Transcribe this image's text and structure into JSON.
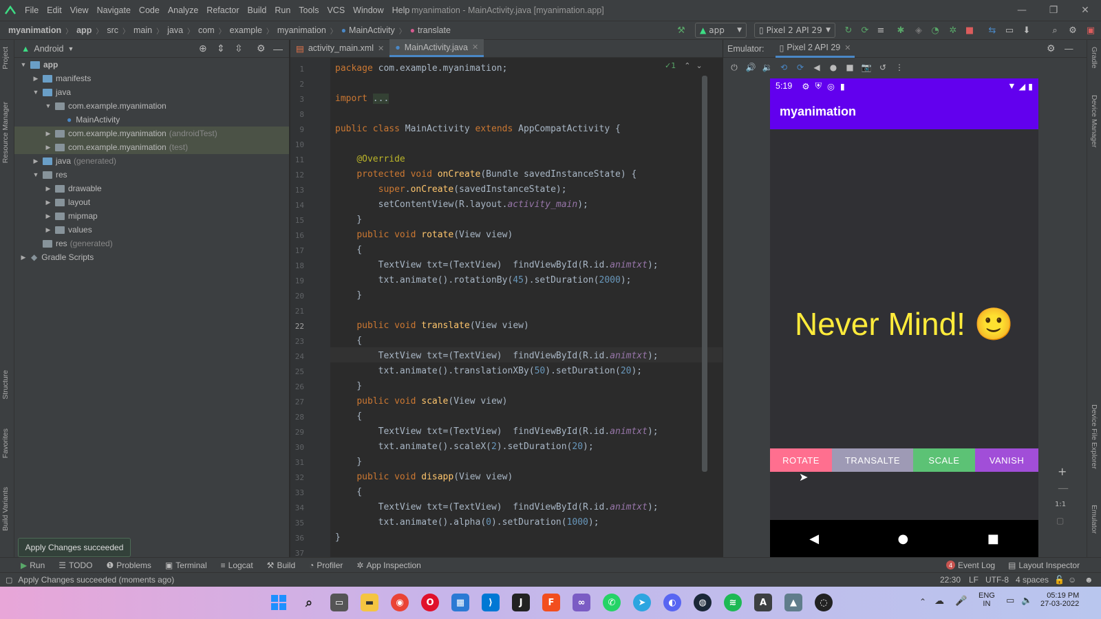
{
  "menu": {
    "items": [
      "File",
      "Edit",
      "View",
      "Navigate",
      "Code",
      "Analyze",
      "Refactor",
      "Build",
      "Run",
      "Tools",
      "VCS",
      "Window",
      "Help"
    ],
    "window_title": "myanimation - MainActivity.java [myanimation.app]"
  },
  "breadcrumb": [
    "myanimation",
    "app",
    "src",
    "main",
    "java",
    "com",
    "example",
    "myanimation",
    "MainActivity",
    "translate"
  ],
  "toolbar": {
    "run_config": "app",
    "device": "Pixel 2 API 29"
  },
  "left_strip": {
    "project": "Project",
    "resource_manager": "Resource Manager",
    "structure": "Structure",
    "favorites": "Favorites",
    "build_variants": "Build Variants"
  },
  "right_strip": {
    "gradle": "Gradle",
    "device_manager": "Device Manager",
    "device_file_explorer": "Device File Explorer",
    "emulator": "Emulator"
  },
  "project": {
    "view_mode": "Android",
    "tree": [
      {
        "label": "app",
        "hint": "",
        "bold": true
      },
      {
        "label": "manifests",
        "hint": ""
      },
      {
        "label": "java",
        "hint": ""
      },
      {
        "label": "com.example.myanimation",
        "hint": ""
      },
      {
        "label": "MainActivity",
        "hint": ""
      },
      {
        "label": "com.example.myanimation",
        "hint": "(androidTest)"
      },
      {
        "label": "com.example.myanimation",
        "hint": "(test)"
      },
      {
        "label": "java",
        "hint": "(generated)"
      },
      {
        "label": "res",
        "hint": ""
      },
      {
        "label": "drawable",
        "hint": ""
      },
      {
        "label": "layout",
        "hint": ""
      },
      {
        "label": "mipmap",
        "hint": ""
      },
      {
        "label": "values",
        "hint": ""
      },
      {
        "label": "res",
        "hint": "(generated)"
      },
      {
        "label": "Gradle Scripts",
        "hint": ""
      }
    ]
  },
  "editor": {
    "tabs": [
      "activity_main.xml",
      "MainActivity.java"
    ],
    "inspection_count": "1",
    "line_numbers": [
      "1",
      "2",
      "3",
      "8",
      "9",
      "10",
      "11",
      "12",
      "13",
      "14",
      "15",
      "16",
      "17",
      "18",
      "19",
      "20",
      "21",
      "22",
      "23",
      "24",
      "25",
      "26",
      "27",
      "28",
      "29",
      "30",
      "31",
      "32",
      "33",
      "34",
      "35",
      "36",
      "37"
    ],
    "code": [
      "package com.example.myanimation;",
      "",
      "import ...",
      "",
      "public class MainActivity extends AppCompatActivity {",
      "",
      "    @Override",
      "    protected void onCreate(Bundle savedInstanceState) {",
      "        super.onCreate(savedInstanceState);",
      "        setContentView(R.layout.activity_main);",
      "    }",
      "    public void rotate(View view)",
      "    {",
      "        TextView txt=(TextView)  findViewById(R.id.animtxt);",
      "        txt.animate().rotationBy(45).setDuration(2000);",
      "    }",
      "",
      "    public void translate(View view)",
      "    {",
      "        TextView txt=(TextView)  findViewById(R.id.animtxt);",
      "        txt.animate().translationXBy(50).setDuration(20);",
      "    }",
      "    public void scale(View view)",
      "    {",
      "        TextView txt=(TextView)  findViewById(R.id.animtxt);",
      "        txt.animate().scaleX(2).setDuration(20);",
      "    }",
      "    public void disapp(View view)",
      "    {",
      "        TextView txt=(TextView)  findViewById(R.id.animtxt);",
      "        txt.animate().alpha(0).setDuration(1000);",
      "}",
      ""
    ]
  },
  "emulator": {
    "label": "Emulator:",
    "device_tab": "Pixel 2 API 29",
    "phone": {
      "time": "5:19",
      "app_title": "myanimation",
      "big_text": "Never Mind! 🙂",
      "buttons": [
        {
          "label": "ROTATE",
          "color": "#ff6f8f"
        },
        {
          "label": "TRANSALTE",
          "color": "#9e9ab5"
        },
        {
          "label": "SCALE",
          "color": "#5cc275"
        },
        {
          "label": "VANISH",
          "color": "#a14ed8"
        }
      ]
    },
    "zoom_reset": "1:1"
  },
  "toast": "Apply Changes succeeded",
  "tool_windows": {
    "left": [
      "Run",
      "TODO",
      "Problems",
      "Terminal",
      "Logcat",
      "Build",
      "Profiler",
      "App Inspection"
    ],
    "event_log": "Event Log",
    "event_count": "4",
    "layout_inspector": "Layout Inspector"
  },
  "status": {
    "message": "Apply Changes succeeded (moments ago)",
    "position": "22:30",
    "line_sep": "LF",
    "encoding": "UTF-8",
    "indent": "4 spaces"
  },
  "taskbar": {
    "lang": "ENG",
    "region": "IN",
    "time": "05:19 PM",
    "date": "27-03-2022"
  }
}
